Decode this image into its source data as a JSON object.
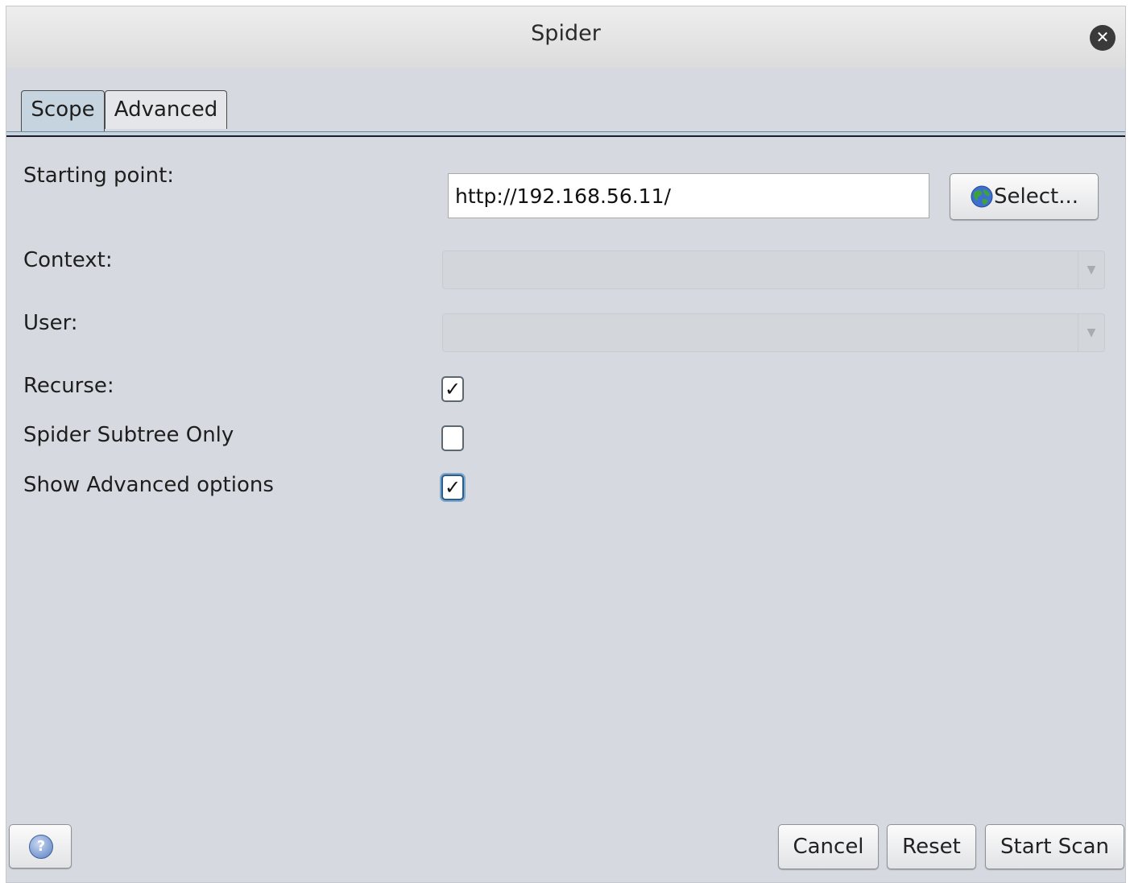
{
  "window": {
    "title": "Spider",
    "close_icon": "close-icon"
  },
  "tabs": [
    {
      "label": "Scope",
      "active": true
    },
    {
      "label": "Advanced",
      "active": false
    }
  ],
  "form": {
    "starting_point": {
      "label": "Starting point:",
      "value": "http://192.168.56.11/",
      "select_button": "Select...",
      "icon": "globe-icon"
    },
    "context": {
      "label": "Context:",
      "value": ""
    },
    "user": {
      "label": "User:",
      "value": ""
    },
    "recurse": {
      "label": "Recurse:",
      "checked": true
    },
    "subtree_only": {
      "label": "Spider Subtree Only",
      "checked": false
    },
    "show_advanced": {
      "label": "Show Advanced options",
      "checked": true
    }
  },
  "footer": {
    "help_icon": "help-icon",
    "cancel": "Cancel",
    "reset": "Reset",
    "start_scan": "Start Scan"
  }
}
